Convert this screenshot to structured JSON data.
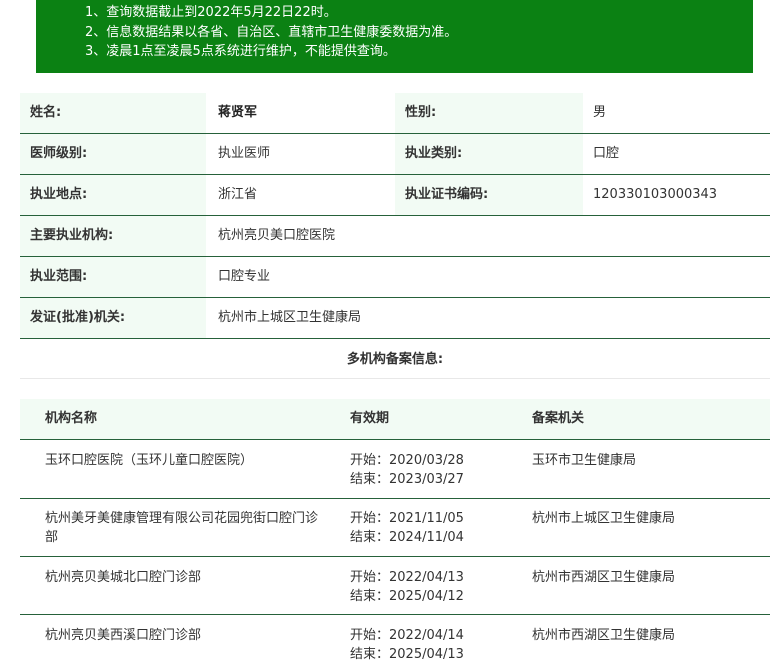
{
  "notice": {
    "lines": [
      "1、查询数据截止到2022年5月22日22时。",
      "2、信息数据结果以各省、自治区、直辖市卫生健康委数据为准。",
      "3、凌晨1点至凌晨5点系统进行维护，不能提供查询。"
    ]
  },
  "info": {
    "name_label": "姓名:",
    "name_value": "蒋贤军",
    "gender_label": "性别:",
    "gender_value": "男",
    "level_label": "医师级别:",
    "level_value": "执业医师",
    "category_label": "执业类别:",
    "category_value": "口腔",
    "location_label": "执业地点:",
    "location_value": "浙江省",
    "cert_label": "执业证书编码:",
    "cert_value": "120330103000343",
    "org_label": "主要执业机构:",
    "org_value": "杭州亮贝美口腔医院",
    "scope_label": "执业范围:",
    "scope_value": "口腔专业",
    "issuer_label": "发证(批准)机关:",
    "issuer_value": "杭州市上城区卫生健康局"
  },
  "multi": {
    "title": "多机构备案信息:",
    "headers": {
      "name": "机构名称",
      "validity": "有效期",
      "authority": "备案机关"
    },
    "rows": [
      {
        "name": "玉环口腔医院（玉环儿童口腔医院）",
        "start": "开始：2020/03/28",
        "end": "结束：2023/03/27",
        "authority": "玉环市卫生健康局"
      },
      {
        "name": "杭州美牙美健康管理有限公司花园兜街口腔门诊部",
        "start": "开始：2021/11/05",
        "end": "结束：2024/11/04",
        "authority": "杭州市上城区卫生健康局"
      },
      {
        "name": "杭州亮贝美城北口腔门诊部",
        "start": "开始：2022/04/13",
        "end": "结束：2025/04/12",
        "authority": "杭州市西湖区卫生健康局"
      },
      {
        "name": "杭州亮贝美西溪口腔门诊部",
        "start": "开始：2022/04/14",
        "end": "结束：2025/04/13",
        "authority": "杭州市西湖区卫生健康局"
      }
    ]
  }
}
